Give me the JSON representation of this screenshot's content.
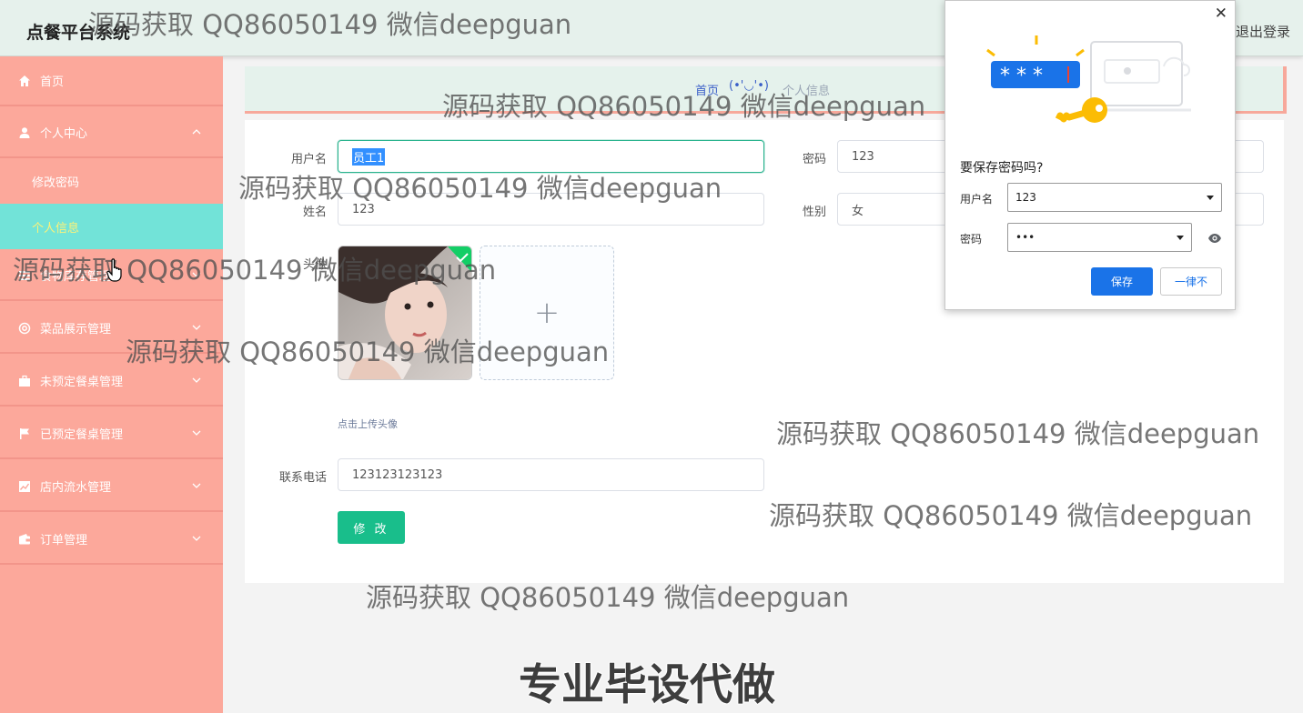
{
  "app": {
    "title": "点餐平台系统",
    "logout_label": "退出登录"
  },
  "sidebar": {
    "items": [
      {
        "label": "首页",
        "icon": "home-icon"
      },
      {
        "label": "个人中心",
        "icon": "user-icon",
        "expanded": true,
        "children": [
          {
            "label": "修改密码"
          },
          {
            "label": "个人信息",
            "active": true
          }
        ]
      },
      {
        "label": "食物库存管理",
        "icon": "list-icon"
      },
      {
        "label": "菜品展示管理",
        "icon": "settings-icon"
      },
      {
        "label": "未预定餐桌管理",
        "icon": "briefcase-icon"
      },
      {
        "label": "已预定餐桌管理",
        "icon": "flag-icon"
      },
      {
        "label": "店内流水管理",
        "icon": "chart-icon"
      },
      {
        "label": "订单管理",
        "icon": "wallet-icon"
      }
    ]
  },
  "breadcrumb": {
    "home": "首页",
    "separator": "(•'◡'•)",
    "current": "个人信息"
  },
  "form": {
    "username_label": "用户名",
    "username_value": "员工1",
    "password_label": "密码",
    "password_value": "123",
    "name_label": "姓名",
    "name_value": "123",
    "gender_label": "性别",
    "gender_value": "女",
    "avatar_label": "头像",
    "upload_tip": "点击上传头像",
    "upload_plus": "+",
    "phone_label": "联系电话",
    "phone_value": "123123123123",
    "submit_label": "修 改"
  },
  "save_password_popup": {
    "title": "要保存密码吗?",
    "username_label": "用户名",
    "username_value": "123",
    "password_label": "密码",
    "password_value": "•••",
    "save_label": "保存",
    "never_label": "一律不",
    "illustration_text": "* * *",
    "close_glyph": "✕"
  },
  "overlays": {
    "watermark_text": "源码获取 QQ86050149 微信deepguan",
    "banner_text": "专业毕设代做"
  },
  "colors": {
    "sidebar_bg": "#fca89b",
    "sidebar_active_bg": "#72e3d8",
    "sidebar_active_text": "#fbf27a",
    "topbar_bg": "#e6f1ec",
    "primary_button": "#19be8b",
    "chrome_blue": "#1a73e8"
  }
}
